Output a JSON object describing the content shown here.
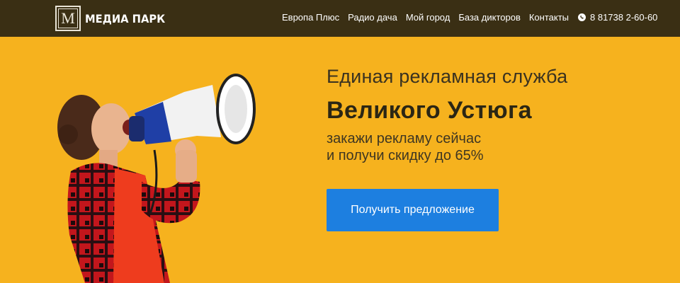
{
  "header": {
    "logo_letter": "M",
    "logo_text": "МЕДИА ПАРК",
    "nav": [
      {
        "label": "Европа Плюс"
      },
      {
        "label": "Радио дача"
      },
      {
        "label": "Мой город"
      },
      {
        "label": "База дикторов"
      },
      {
        "label": "Контакты"
      }
    ],
    "phone": "8 81738 2-60-60",
    "phone_icon": "phone-icon"
  },
  "hero": {
    "title_line1": "Единая рекламная служба",
    "title_line2": "Великого Устюга",
    "subtitle_line1": "закажи рекламу сейчас",
    "subtitle_line2": "и получи скидку до 65%",
    "cta_label": "Получить предложение",
    "image": "woman-shouting-into-megaphone"
  },
  "colors": {
    "topbar": "#3a2f14",
    "background": "#f6b21e",
    "cta": "#1d7fe0"
  }
}
